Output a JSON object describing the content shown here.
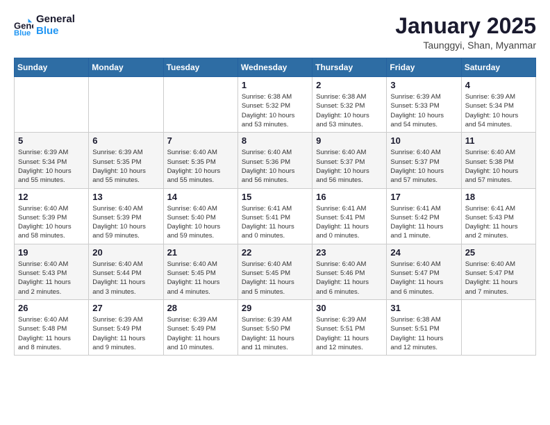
{
  "header": {
    "logo_line1": "General",
    "logo_line2": "Blue",
    "month": "January 2025",
    "location": "Taunggyi, Shan, Myanmar"
  },
  "weekdays": [
    "Sunday",
    "Monday",
    "Tuesday",
    "Wednesday",
    "Thursday",
    "Friday",
    "Saturday"
  ],
  "weeks": [
    [
      {
        "day": "",
        "info": ""
      },
      {
        "day": "",
        "info": ""
      },
      {
        "day": "",
        "info": ""
      },
      {
        "day": "1",
        "info": "Sunrise: 6:38 AM\nSunset: 5:32 PM\nDaylight: 10 hours\nand 53 minutes."
      },
      {
        "day": "2",
        "info": "Sunrise: 6:38 AM\nSunset: 5:32 PM\nDaylight: 10 hours\nand 53 minutes."
      },
      {
        "day": "3",
        "info": "Sunrise: 6:39 AM\nSunset: 5:33 PM\nDaylight: 10 hours\nand 54 minutes."
      },
      {
        "day": "4",
        "info": "Sunrise: 6:39 AM\nSunset: 5:34 PM\nDaylight: 10 hours\nand 54 minutes."
      }
    ],
    [
      {
        "day": "5",
        "info": "Sunrise: 6:39 AM\nSunset: 5:34 PM\nDaylight: 10 hours\nand 55 minutes."
      },
      {
        "day": "6",
        "info": "Sunrise: 6:39 AM\nSunset: 5:35 PM\nDaylight: 10 hours\nand 55 minutes."
      },
      {
        "day": "7",
        "info": "Sunrise: 6:40 AM\nSunset: 5:35 PM\nDaylight: 10 hours\nand 55 minutes."
      },
      {
        "day": "8",
        "info": "Sunrise: 6:40 AM\nSunset: 5:36 PM\nDaylight: 10 hours\nand 56 minutes."
      },
      {
        "day": "9",
        "info": "Sunrise: 6:40 AM\nSunset: 5:37 PM\nDaylight: 10 hours\nand 56 minutes."
      },
      {
        "day": "10",
        "info": "Sunrise: 6:40 AM\nSunset: 5:37 PM\nDaylight: 10 hours\nand 57 minutes."
      },
      {
        "day": "11",
        "info": "Sunrise: 6:40 AM\nSunset: 5:38 PM\nDaylight: 10 hours\nand 57 minutes."
      }
    ],
    [
      {
        "day": "12",
        "info": "Sunrise: 6:40 AM\nSunset: 5:39 PM\nDaylight: 10 hours\nand 58 minutes."
      },
      {
        "day": "13",
        "info": "Sunrise: 6:40 AM\nSunset: 5:39 PM\nDaylight: 10 hours\nand 59 minutes."
      },
      {
        "day": "14",
        "info": "Sunrise: 6:40 AM\nSunset: 5:40 PM\nDaylight: 10 hours\nand 59 minutes."
      },
      {
        "day": "15",
        "info": "Sunrise: 6:41 AM\nSunset: 5:41 PM\nDaylight: 11 hours\nand 0 minutes."
      },
      {
        "day": "16",
        "info": "Sunrise: 6:41 AM\nSunset: 5:41 PM\nDaylight: 11 hours\nand 0 minutes."
      },
      {
        "day": "17",
        "info": "Sunrise: 6:41 AM\nSunset: 5:42 PM\nDaylight: 11 hours\nand 1 minute."
      },
      {
        "day": "18",
        "info": "Sunrise: 6:41 AM\nSunset: 5:43 PM\nDaylight: 11 hours\nand 2 minutes."
      }
    ],
    [
      {
        "day": "19",
        "info": "Sunrise: 6:40 AM\nSunset: 5:43 PM\nDaylight: 11 hours\nand 2 minutes."
      },
      {
        "day": "20",
        "info": "Sunrise: 6:40 AM\nSunset: 5:44 PM\nDaylight: 11 hours\nand 3 minutes."
      },
      {
        "day": "21",
        "info": "Sunrise: 6:40 AM\nSunset: 5:45 PM\nDaylight: 11 hours\nand 4 minutes."
      },
      {
        "day": "22",
        "info": "Sunrise: 6:40 AM\nSunset: 5:45 PM\nDaylight: 11 hours\nand 5 minutes."
      },
      {
        "day": "23",
        "info": "Sunrise: 6:40 AM\nSunset: 5:46 PM\nDaylight: 11 hours\nand 6 minutes."
      },
      {
        "day": "24",
        "info": "Sunrise: 6:40 AM\nSunset: 5:47 PM\nDaylight: 11 hours\nand 6 minutes."
      },
      {
        "day": "25",
        "info": "Sunrise: 6:40 AM\nSunset: 5:47 PM\nDaylight: 11 hours\nand 7 minutes."
      }
    ],
    [
      {
        "day": "26",
        "info": "Sunrise: 6:40 AM\nSunset: 5:48 PM\nDaylight: 11 hours\nand 8 minutes."
      },
      {
        "day": "27",
        "info": "Sunrise: 6:39 AM\nSunset: 5:49 PM\nDaylight: 11 hours\nand 9 minutes."
      },
      {
        "day": "28",
        "info": "Sunrise: 6:39 AM\nSunset: 5:49 PM\nDaylight: 11 hours\nand 10 minutes."
      },
      {
        "day": "29",
        "info": "Sunrise: 6:39 AM\nSunset: 5:50 PM\nDaylight: 11 hours\nand 11 minutes."
      },
      {
        "day": "30",
        "info": "Sunrise: 6:39 AM\nSunset: 5:51 PM\nDaylight: 11 hours\nand 12 minutes."
      },
      {
        "day": "31",
        "info": "Sunrise: 6:38 AM\nSunset: 5:51 PM\nDaylight: 11 hours\nand 12 minutes."
      },
      {
        "day": "",
        "info": ""
      }
    ]
  ]
}
